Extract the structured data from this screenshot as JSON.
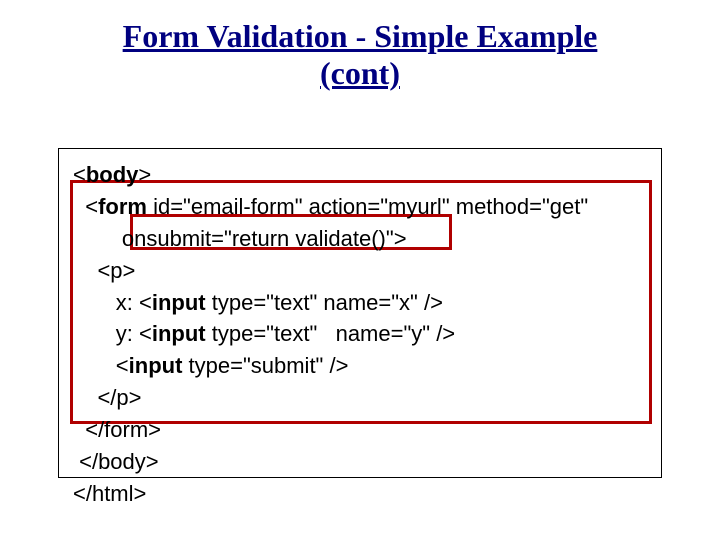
{
  "title_line1": "Form Validation - Simple Example",
  "title_line2": "(cont)",
  "code": {
    "l1a": "<",
    "l1b": "body",
    "l1c": ">",
    "l2a": "  <",
    "l2b": "form",
    "l2c": " id=\"email-form\" action=\"myurl\" method=\"get\"",
    "l3": "        onsubmit=\"return validate()\">",
    "l4": "    <p>",
    "l5a": "       x: <",
    "l5b": "input",
    "l5c": " type=\"text\" name=\"x\" />",
    "l6a": "       y: <",
    "l6b": "input",
    "l6c": " type=\"text\"   name=\"y\" />",
    "l7a": "       <",
    "l7b": "input",
    "l7c": " type=\"submit\" />",
    "l8": "    </p>",
    "l9": "  </form>",
    "l10": " </body>",
    "l11": "</html>"
  }
}
